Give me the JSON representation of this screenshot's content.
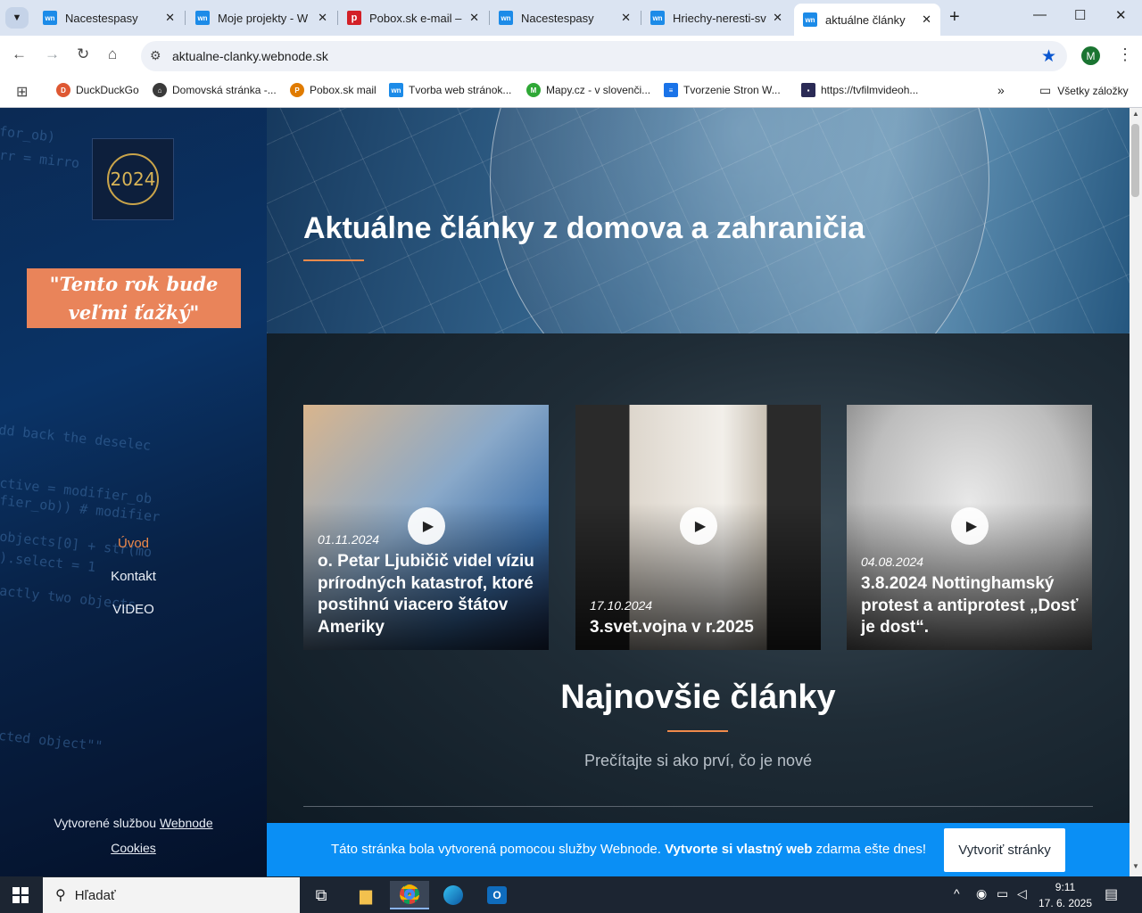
{
  "browser": {
    "tabs": [
      {
        "title": "Nacestespasy",
        "icon": "webnode-favicon",
        "active": false
      },
      {
        "title": "Moje projekty - W",
        "icon": "webnode-favicon",
        "active": false
      },
      {
        "title": "Pobox.sk e-mail – p",
        "icon": "pobox-favicon",
        "active": false
      },
      {
        "title": "Nacestespasy",
        "icon": "webnode-favicon",
        "active": false
      },
      {
        "title": "Hriechy-neresti-sv",
        "icon": "webnode-favicon",
        "active": false
      },
      {
        "title": "aktuálne články",
        "icon": "webnode-favicon",
        "active": true
      }
    ],
    "url": "aktualne-clanky.webnode.sk",
    "profile_initial": "M",
    "bookmarks": [
      {
        "label": "DuckDuckGo",
        "icon": "duckduckgo-icon",
        "color": "#de5833"
      },
      {
        "label": "Domovská stránka -...",
        "icon": "home-page-icon",
        "color": "#3a3a3a"
      },
      {
        "label": "Pobox.sk mail",
        "icon": "pobox-icon",
        "color": "#e07b00"
      },
      {
        "label": "Tvorba web stránok...",
        "icon": "webnode-icon",
        "color": "#1c8be8"
      },
      {
        "label": "Mapy.cz - v slovenči...",
        "icon": "mapy-icon",
        "color": "#2fa836"
      },
      {
        "label": "Tvorzenie Stron W...",
        "icon": "document-icon",
        "color": "#1a73e8"
      },
      {
        "label": "https://tvfilmvideoh...",
        "icon": "tvfilm-icon",
        "color": "#2a2a55"
      }
    ],
    "all_bookmarks_label": "Všetky záložky",
    "more_label": "»"
  },
  "sidebar": {
    "logo_text": "2024",
    "quote_line1": "\"Tento rok bude",
    "quote_line2": "veľmi ťažký\"",
    "menu": [
      {
        "label": "Úvod",
        "active": true
      },
      {
        "label": "Kontakt",
        "active": false
      },
      {
        "label": "VIDEO",
        "active": false
      }
    ],
    "footer_prefix": "Vytvorené službou ",
    "footer_link": "Webnode",
    "cookies": "Cookies"
  },
  "hero": {
    "title": "Aktuálne články z domova a zahraničia"
  },
  "cards": [
    {
      "date": "01.11.2024",
      "title": "o. Petar Ljubičič videl víziu prírodných katastrof, ktoré postihnú viacero štátov Ameriky"
    },
    {
      "date": "17.10.2024",
      "title": "3.svet.vojna v r.2025"
    },
    {
      "date": "04.08.2024",
      "title": "3.8.2024 Nottinghamský protest a antiprotest „Dosť je dost“."
    }
  ],
  "latest": {
    "title": "Najnovšie články",
    "subtitle": "Prečítajte si ako prví, čo je nové"
  },
  "banner": {
    "text_before": "Táto stránka bola vytvorená pomocou služby Webnode. ",
    "text_bold": "Vytvorte si vlastný web",
    "text_after": " zdarma ešte dnes!",
    "button": "Vytvoriť stránky"
  },
  "taskbar": {
    "search_placeholder": "Hľadať",
    "time": "9:11",
    "date": "17. 6. 2025"
  },
  "colors": {
    "accent": "#f08a4b",
    "quote_bg": "#e9845a",
    "banner_bg": "#0a8ff5",
    "bookmark_blue": "#0b57d0"
  }
}
